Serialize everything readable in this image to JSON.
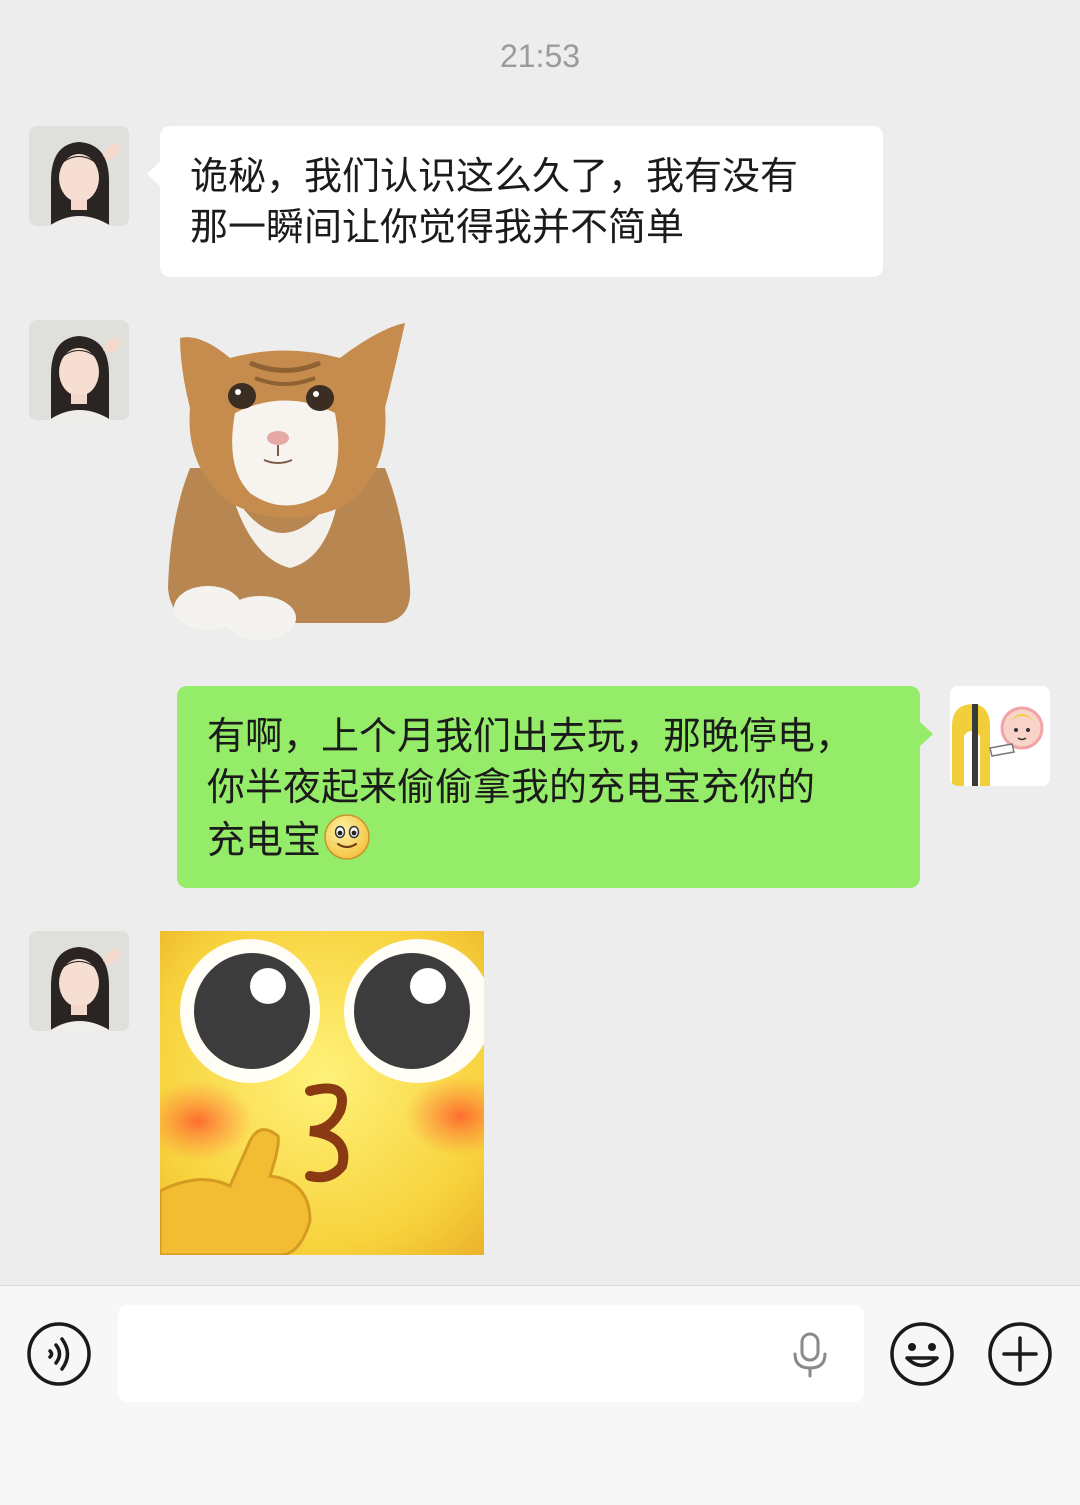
{
  "timestamp": "21:53",
  "messages": [
    {
      "sender": "contact",
      "type": "text",
      "line1": "诡秘，我们认识这么久了，我有没有",
      "line2": "那一瞬间让你觉得我并不简单"
    },
    {
      "sender": "contact",
      "type": "sticker",
      "sticker": "orange-tabby-cat"
    },
    {
      "sender": "me",
      "type": "text",
      "line1": "有啊，上个月我们出去玩，那晚停电，",
      "line2": "你半夜起来偷偷拿我的充电宝充你的",
      "line3": "充电宝",
      "emoji": "smiling-face"
    },
    {
      "sender": "contact",
      "type": "sticker",
      "sticker": "yellow-face-shush"
    }
  ],
  "input_bar": {
    "text_value": "",
    "icons": [
      "voice-mode-icon",
      "microphone-icon",
      "emoji-icon",
      "plus-icon"
    ]
  },
  "colors": {
    "background": "#ededed",
    "my_bubble": "#95ec69",
    "contact_bubble": "#ffffff",
    "timestamp": "#9b9b9b"
  }
}
